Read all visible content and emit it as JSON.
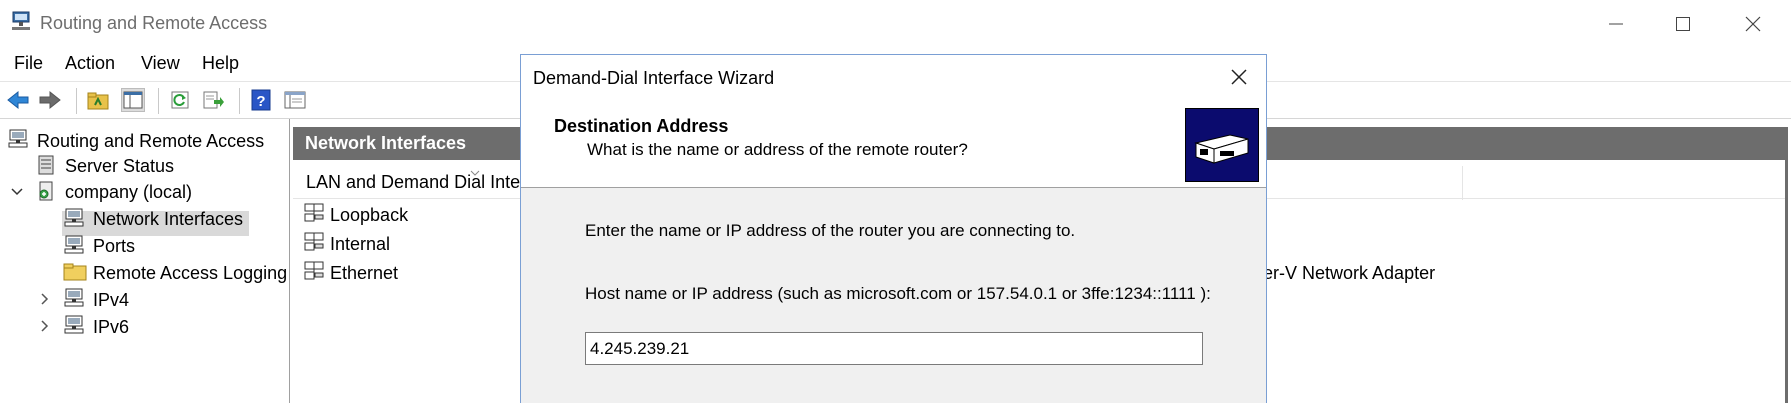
{
  "window": {
    "title": "Routing and Remote Access"
  },
  "menu": {
    "items": [
      "File",
      "Action",
      "View",
      "Help"
    ]
  },
  "toolbar": {
    "buttons": [
      "back-arrow-icon",
      "forward-arrow-icon",
      "up-folder-icon",
      "show-hide-tree-icon",
      "refresh-icon",
      "export-list-icon",
      "help-icon",
      "properties-icon"
    ]
  },
  "tree": {
    "root": "Routing and Remote Access",
    "server_status": "Server Status",
    "server": "company (local)",
    "network_interfaces": "Network Interfaces",
    "ports": "Ports",
    "remote_access_logging": "Remote Access Logging",
    "ipv4": "IPv4",
    "ipv6": "IPv6"
  },
  "main": {
    "header": "Network Interfaces",
    "column_header": "LAN and Demand Dial Inter",
    "rows": [
      "Loopback",
      "Internal",
      "Ethernet"
    ],
    "ethernet_device": "per-V Network Adapter"
  },
  "dialog": {
    "title": "Demand-Dial Interface Wizard",
    "header_title": "Destination Address",
    "header_subtitle": "What is the name or address of the remote router?",
    "instruction": "Enter the name or IP address of the router you are connecting to.",
    "host_label": "Host name or IP address (such as microsoft.com or 157.54.0.1 or 3ffe:1234::1111 ):",
    "host_value": "4.245.239.21"
  },
  "colors": {
    "header_bar": "#6d6d6d",
    "selection": "#d9d9d9",
    "dialog_bg": "#f0f0f0",
    "wizard_image": "#0a0a6a"
  }
}
